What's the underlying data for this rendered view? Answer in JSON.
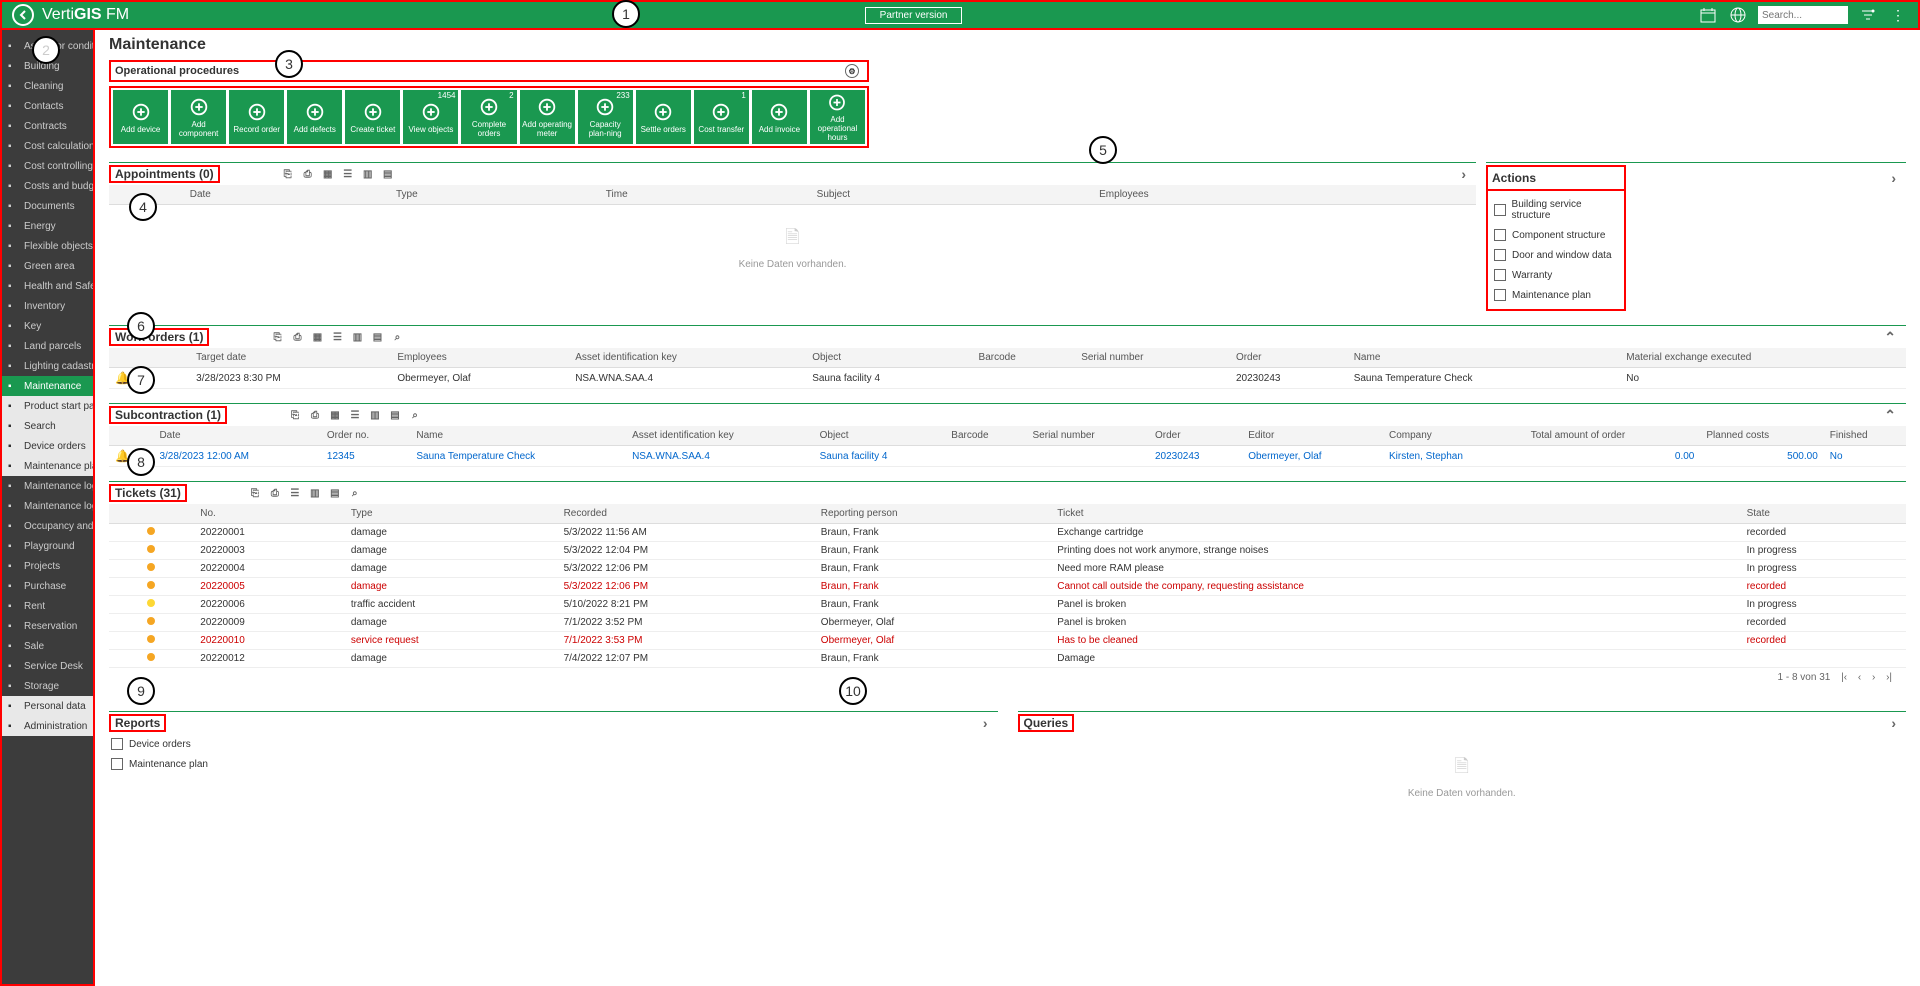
{
  "top": {
    "logo_a": "Verti",
    "logo_b": "GIS",
    "logo_c": " FM",
    "partner": "Partner version",
    "search_ph": "Search..."
  },
  "sidebar": [
    {
      "label": "Assessor condition"
    },
    {
      "label": "Building"
    },
    {
      "label": "Cleaning"
    },
    {
      "label": "Contacts"
    },
    {
      "label": "Contracts"
    },
    {
      "label": "Cost calculation"
    },
    {
      "label": "Cost controlling"
    },
    {
      "label": "Costs and budget"
    },
    {
      "label": "Documents"
    },
    {
      "label": "Energy"
    },
    {
      "label": "Flexible objects"
    },
    {
      "label": "Green area"
    },
    {
      "label": "Health and Safety"
    },
    {
      "label": "Inventory"
    },
    {
      "label": "Key"
    },
    {
      "label": "Land parcels"
    },
    {
      "label": "Lighting cadastre"
    },
    {
      "label": "Maintenance",
      "active": true
    },
    {
      "label": "Product start page",
      "light": true
    },
    {
      "label": "Search",
      "light": true
    },
    {
      "label": "Device orders",
      "light": true
    },
    {
      "label": "Maintenance plan",
      "light": true
    },
    {
      "label": "Maintenance log waste water"
    },
    {
      "label": "Maintenance log water"
    },
    {
      "label": "Occupancy and Relocation"
    },
    {
      "label": "Playground"
    },
    {
      "label": "Projects"
    },
    {
      "label": "Purchase"
    },
    {
      "label": "Rent"
    },
    {
      "label": "Reservation"
    },
    {
      "label": "Sale"
    },
    {
      "label": "Service Desk"
    },
    {
      "label": "Storage"
    },
    {
      "label": "Personal data",
      "light": true
    },
    {
      "label": "Administration",
      "light": true
    }
  ],
  "page_title": "Maintenance",
  "op_head": "Operational procedures",
  "tiles": [
    {
      "label": "Add device"
    },
    {
      "label": "Add component"
    },
    {
      "label": "Record order"
    },
    {
      "label": "Add defects"
    },
    {
      "label": "Create ticket"
    },
    {
      "label": "View objects",
      "badge": "1454"
    },
    {
      "label": "Complete orders",
      "badge": "2"
    },
    {
      "label": "Add operating meter"
    },
    {
      "label": "Capacity plan-ning",
      "badge": "233"
    },
    {
      "label": "Settle orders"
    },
    {
      "label": "Cost transfer",
      "badge": "1"
    },
    {
      "label": "Add invoice"
    },
    {
      "label": "Add operational hours"
    }
  ],
  "appt": {
    "title": "Appointments   (0)",
    "cols": [
      "",
      "Date",
      "Type",
      "Time",
      "Subject",
      "Employees"
    ],
    "empty": "Keine Daten vorhanden."
  },
  "actions": {
    "title": "Actions",
    "items": [
      "Building service structure",
      "Component structure",
      "Door and window data",
      "Warranty",
      "Maintenance plan"
    ]
  },
  "wo": {
    "title": "Work orders (1)",
    "cols": [
      "",
      "",
      "Target date",
      "Employees",
      "Asset identification key",
      "Object",
      "Barcode",
      "Serial number",
      "Order",
      "Name",
      "Material exchange executed"
    ],
    "rows": [
      {
        "bell": "●",
        "date": "3/28/2023 8:30 PM",
        "emp": "Obermeyer, Olaf",
        "asset": "NSA.WNA.SAA.4",
        "obj": "Sauna facility 4",
        "order": "20230243",
        "name": "Sauna Temperature Check",
        "mat": "No"
      }
    ]
  },
  "sub": {
    "title": "Subcontraction (1)",
    "cols": [
      "",
      "Date",
      "Order no.",
      "Name",
      "Asset identification key",
      "Object",
      "Barcode",
      "Serial number",
      "Order",
      "Editor",
      "Company",
      "Total amount of order",
      "Planned costs",
      "Finished"
    ],
    "rows": [
      {
        "date": "3/28/2023 12:00 AM",
        "ono": "12345",
        "name": "Sauna Temperature Check",
        "asset": "NSA.WNA.SAA.4",
        "obj": "Sauna facility 4",
        "order": "20230243",
        "editor": "Obermeyer, Olaf",
        "comp": "Kirsten, Stephan",
        "total": "0.00",
        "plan": "500.00",
        "fin": "No"
      }
    ]
  },
  "tix": {
    "title": "Tickets (31)",
    "cols": [
      "",
      "",
      "No.",
      "Type",
      "Recorded",
      "Reporting person",
      "Ticket",
      "State"
    ],
    "rows": [
      {
        "dot": "o",
        "no": "20220001",
        "type": "damage",
        "rec": "5/3/2022 11:56 AM",
        "rep": "Braun, Frank",
        "t": "Exchange cartridge",
        "st": "recorded"
      },
      {
        "dot": "o",
        "no": "20220003",
        "type": "damage",
        "rec": "5/3/2022 12:04 PM",
        "rep": "Braun, Frank",
        "t": "Printing does not work anymore, strange noises",
        "st": "In progress"
      },
      {
        "dot": "o",
        "no": "20220004",
        "type": "damage",
        "rec": "5/3/2022 12:06 PM",
        "rep": "Braun, Frank",
        "t": "Need more RAM please",
        "st": "In progress"
      },
      {
        "dot": "o",
        "no": "20220005",
        "type": "damage",
        "rec": "5/3/2022 12:06 PM",
        "rep": "Braun, Frank",
        "t": "Cannot call outside the company, requesting assistance",
        "st": "recorded",
        "red": true
      },
      {
        "dot": "y",
        "no": "20220006",
        "type": "traffic accident",
        "rec": "5/10/2022 8:21 PM",
        "rep": "Braun, Frank",
        "t": "Panel is broken",
        "st": "In progress"
      },
      {
        "dot": "o",
        "no": "20220009",
        "type": "damage",
        "rec": "7/1/2022 3:52 PM",
        "rep": "Obermeyer, Olaf",
        "t": "Panel is broken",
        "st": "recorded"
      },
      {
        "dot": "o",
        "no": "20220010",
        "type": "service request",
        "rec": "7/1/2022 3:53 PM",
        "rep": "Obermeyer, Olaf",
        "t": "Has to be cleaned",
        "st": "recorded",
        "red": true
      },
      {
        "dot": "o",
        "no": "20220012",
        "type": "damage",
        "rec": "7/4/2022 12:07 PM",
        "rep": "Braun, Frank",
        "t": "Damage",
        "st": ""
      }
    ],
    "pager": "1 - 8 von 31"
  },
  "reports": {
    "title": "Reports",
    "items": [
      "Device orders",
      "Maintenance plan"
    ]
  },
  "queries": {
    "title": "Queries",
    "empty": "Keine Daten vorhanden."
  }
}
